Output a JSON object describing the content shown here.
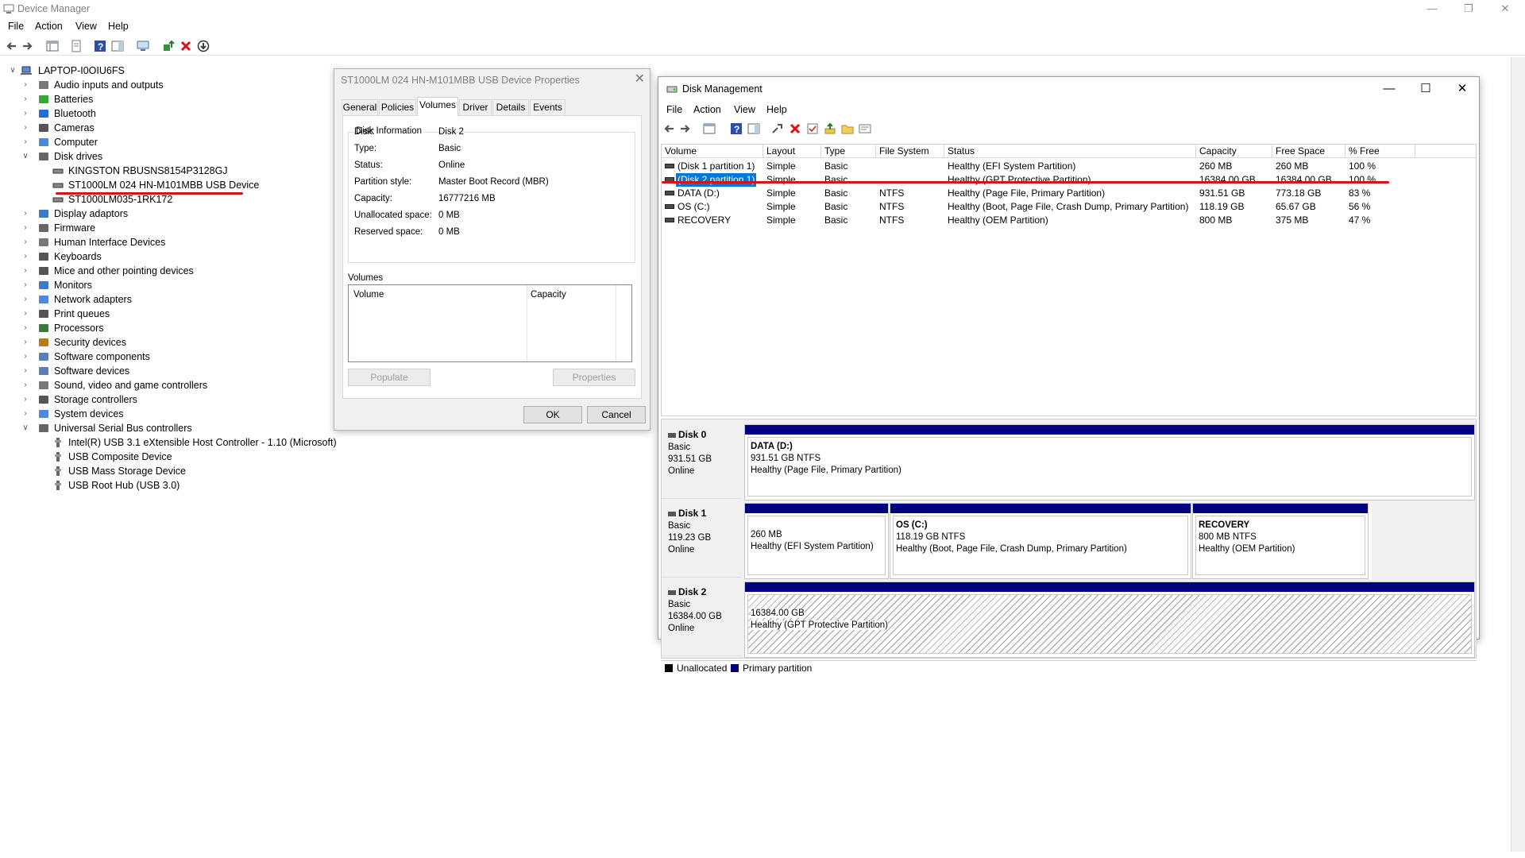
{
  "device_manager": {
    "title": "Device Manager",
    "menu": [
      "File",
      "Action",
      "View",
      "Help"
    ],
    "tree": {
      "root": "LAPTOP-I0OIU6FS",
      "categories": [
        {
          "label": "Audio inputs and outputs",
          "icon": "speaker-icon",
          "expanded": false
        },
        {
          "label": "Batteries",
          "icon": "battery-icon",
          "expanded": false
        },
        {
          "label": "Bluetooth",
          "icon": "bluetooth-icon",
          "expanded": false
        },
        {
          "label": "Cameras",
          "icon": "camera-icon",
          "expanded": false
        },
        {
          "label": "Computer",
          "icon": "computer-icon",
          "expanded": false
        },
        {
          "label": "Disk drives",
          "icon": "disk-drive-icon",
          "expanded": true
        },
        {
          "label": "Display adaptors",
          "icon": "display-icon",
          "expanded": false
        },
        {
          "label": "Firmware",
          "icon": "firmware-icon",
          "expanded": false
        },
        {
          "label": "Human Interface Devices",
          "icon": "hid-icon",
          "expanded": false
        },
        {
          "label": "Keyboards",
          "icon": "keyboard-icon",
          "expanded": false
        },
        {
          "label": "Mice and other pointing devices",
          "icon": "mouse-icon",
          "expanded": false
        },
        {
          "label": "Monitors",
          "icon": "monitor-icon",
          "expanded": false
        },
        {
          "label": "Network adapters",
          "icon": "network-icon",
          "expanded": false
        },
        {
          "label": "Print queues",
          "icon": "printer-icon",
          "expanded": false
        },
        {
          "label": "Processors",
          "icon": "processor-icon",
          "expanded": false
        },
        {
          "label": "Security devices",
          "icon": "security-icon",
          "expanded": false
        },
        {
          "label": "Software components",
          "icon": "software-component-icon",
          "expanded": false
        },
        {
          "label": "Software devices",
          "icon": "software-device-icon",
          "expanded": false
        },
        {
          "label": "Sound, video and game controllers",
          "icon": "sound-icon",
          "expanded": false
        },
        {
          "label": "Storage controllers",
          "icon": "storage-icon",
          "expanded": false
        },
        {
          "label": "System devices",
          "icon": "system-icon",
          "expanded": false
        },
        {
          "label": "Universal Serial Bus controllers",
          "icon": "usb-icon",
          "expanded": true
        }
      ],
      "disk_drives": [
        "KINGSTON RBUSNS8154P3128GJ",
        "ST1000LM 024 HN-M101MBB USB Device",
        "ST1000LM035-1RK172"
      ],
      "usb_controllers": [
        "Intel(R) USB 3.1 eXtensible Host Controller - 1.10 (Microsoft)",
        "USB Composite Device",
        "USB Mass Storage Device",
        "USB Root Hub (USB 3.0)"
      ]
    }
  },
  "properties_dialog": {
    "title": "ST1000LM 024 HN-M101MBB USB Device Properties",
    "tabs": [
      "General",
      "Policies",
      "Volumes",
      "Driver",
      "Details",
      "Events"
    ],
    "active_tab": "Volumes",
    "disk_info_label": "Disk Information",
    "fields": [
      {
        "label": "Disk:",
        "value": "Disk 2"
      },
      {
        "label": "Type:",
        "value": "Basic"
      },
      {
        "label": "Status:",
        "value": "Online"
      },
      {
        "label": "Partition style:",
        "value": "Master Boot Record (MBR)"
      },
      {
        "label": "Capacity:",
        "value": "16777216 MB"
      },
      {
        "label": "Unallocated space:",
        "value": "0 MB"
      },
      {
        "label": "Reserved space:",
        "value": "0 MB"
      }
    ],
    "volumes_label": "Volumes",
    "volumes_columns": [
      "Volume",
      "Capacity"
    ],
    "populate_label": "Populate",
    "properties_label": "Properties",
    "ok_label": "OK",
    "cancel_label": "Cancel"
  },
  "disk_management": {
    "title": "Disk Management",
    "menu": [
      "File",
      "Action",
      "View",
      "Help"
    ],
    "columns": [
      "Volume",
      "Layout",
      "Type",
      "File System",
      "Status",
      "Capacity",
      "Free Space",
      "% Free"
    ],
    "volumes": [
      {
        "volume": "(Disk 1 partition 1)",
        "layout": "Simple",
        "type": "Basic",
        "fs": "",
        "status": "Healthy (EFI System Partition)",
        "capacity": "260 MB",
        "free": "260 MB",
        "pct": "100 %"
      },
      {
        "volume": "(Disk 2 partition 1)",
        "layout": "Simple",
        "type": "Basic",
        "fs": "",
        "status": "Healthy (GPT Protective Partition)",
        "capacity": "16384.00 GB",
        "free": "16384.00 GB",
        "pct": "100 %"
      },
      {
        "volume": "DATA (D:)",
        "layout": "Simple",
        "type": "Basic",
        "fs": "NTFS",
        "status": "Healthy (Page File, Primary Partition)",
        "capacity": "931.51 GB",
        "free": "773.18 GB",
        "pct": "83 %"
      },
      {
        "volume": "OS (C:)",
        "layout": "Simple",
        "type": "Basic",
        "fs": "NTFS",
        "status": "Healthy (Boot, Page File, Crash Dump, Primary Partition)",
        "capacity": "118.19 GB",
        "free": "65.67 GB",
        "pct": "56 %"
      },
      {
        "volume": "RECOVERY",
        "layout": "Simple",
        "type": "Basic",
        "fs": "NTFS",
        "status": "Healthy (OEM Partition)",
        "capacity": "800 MB",
        "free": "375 MB",
        "pct": "47 %"
      }
    ],
    "disks": [
      {
        "name": "Disk 0",
        "type": "Basic",
        "size": "931.51 GB",
        "status": "Online",
        "partitions": [
          {
            "title": "DATA  (D:)",
            "size": "931.51 GB NTFS",
            "status": "Healthy (Page File, Primary Partition)"
          }
        ]
      },
      {
        "name": "Disk 1",
        "type": "Basic",
        "size": "119.23 GB",
        "status": "Online",
        "partitions": [
          {
            "title": "",
            "size": "260 MB",
            "status": "Healthy (EFI System Partition)"
          },
          {
            "title": "OS  (C:)",
            "size": "118.19 GB NTFS",
            "status": "Healthy (Boot, Page File, Crash Dump, Primary Partition)"
          },
          {
            "title": "RECOVERY",
            "size": "800 MB NTFS",
            "status": "Healthy (OEM Partition)"
          }
        ]
      },
      {
        "name": "Disk 2",
        "type": "Basic",
        "size": "16384.00 GB",
        "status": "Online",
        "partitions": [
          {
            "title": "",
            "size": "16384.00 GB",
            "status": "Healthy (GPT Protective Partition)"
          }
        ]
      }
    ],
    "legend": [
      {
        "label": "Unallocated",
        "color": "#000000"
      },
      {
        "label": "Primary partition",
        "color": "#000080"
      }
    ]
  },
  "colors": {
    "highlight": "#0078d7",
    "annotation": "#d3141b",
    "primary_partition": "#000080"
  }
}
